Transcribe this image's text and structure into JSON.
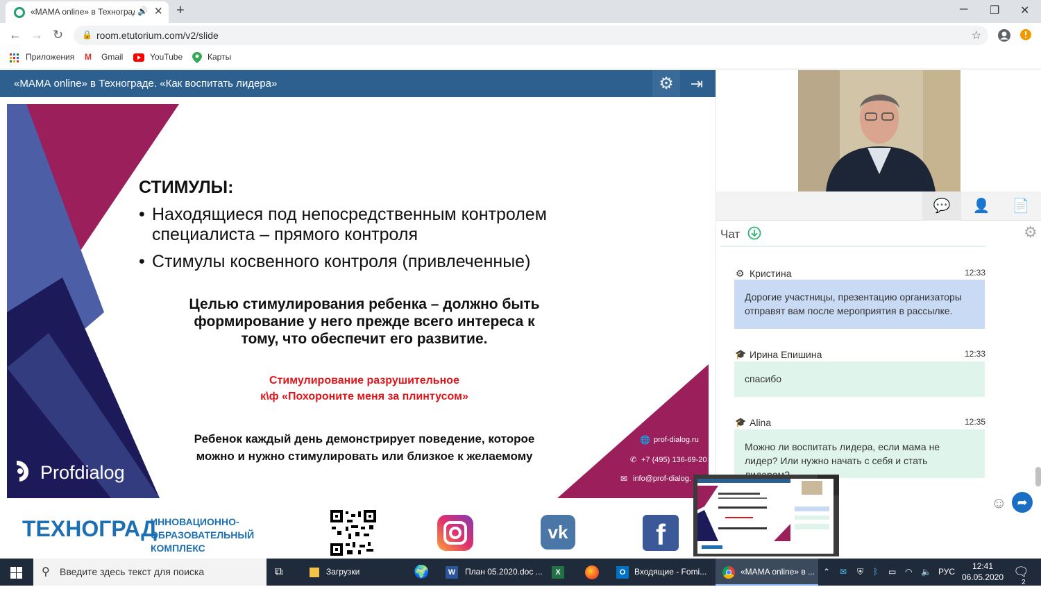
{
  "browser": {
    "tab_title": "«MAMA online» в Техноград",
    "new_tab": "+",
    "url": "room.etutorium.com/v2/slide",
    "bookmarks": [
      "Приложения",
      "Gmail",
      "YouTube",
      "Карты"
    ]
  },
  "header": {
    "title": "«МАМА online» в Технограде. «Как воспитать лидера»"
  },
  "slide": {
    "heading": "СТИМУЛЫ:",
    "bullets": [
      "Находящиеся под непосредственным контролем",
      "специалиста – прямого контроля",
      "Стимулы косвенного контроля (привлеченные)"
    ],
    "goal_lines": [
      "Целью стимулирования ребенка – должно быть",
      "формирование у него прежде всего интереса к",
      "тому, что обеспечит его развитие."
    ],
    "red_lines": [
      "Стимулирование разрушительное",
      "к\\ф «Похороните меня за плинтусом»"
    ],
    "bottom_lines": [
      "Ребенок каждый день демонстрирует поведение, которое",
      "можно и нужно стимулировать или близкое к желаемому"
    ],
    "logo": "Profdialog",
    "contacts": [
      "prof-dialog.ru",
      "+7 (495) 136-69-20",
      "info@prof-dialog."
    ]
  },
  "logostrip": {
    "brand": "ТЕХНОГРАД",
    "subtitle": [
      "ИННОВАЦИОННО-",
      "ОБРАЗОВАТЕЛЬНЫЙ",
      "КОМПЛЕКС"
    ]
  },
  "chat": {
    "title": "Чат",
    "messages": [
      {
        "name": "Кристина",
        "time": "12:33",
        "text": "Дорогие участницы, презентацию организаторы отправят вам после мероприятия в рассылке.",
        "color": "#c9daf5"
      },
      {
        "name": "Ирина Епишина",
        "time": "12:33",
        "text": "спасибо",
        "color": "#dff5ec"
      },
      {
        "name": "Alina",
        "time": "12:35",
        "text": "Можно ли воспитать лидера, если мама не лидер? Или нужно начать с себя и стать лидером?",
        "color": "#dff5ec"
      }
    ]
  },
  "taskbar": {
    "search_placeholder": "Введите здесь текст для поиска",
    "apps": [
      "Загрузки",
      "План 05.2020.doc ...",
      "Входящие - Fomi...",
      "«MAMA online» в ..."
    ],
    "lang": "РУС",
    "time": "12:41",
    "date": "06.05.2020",
    "notif_count": "2"
  },
  "colors": {
    "header_bg": "#2d5f8f",
    "slide_navy": "#1d1a5a",
    "slide_magenta": "#9b1f5a",
    "slide_blue": "#4c5ea6",
    "red_text": "#e0151a"
  }
}
